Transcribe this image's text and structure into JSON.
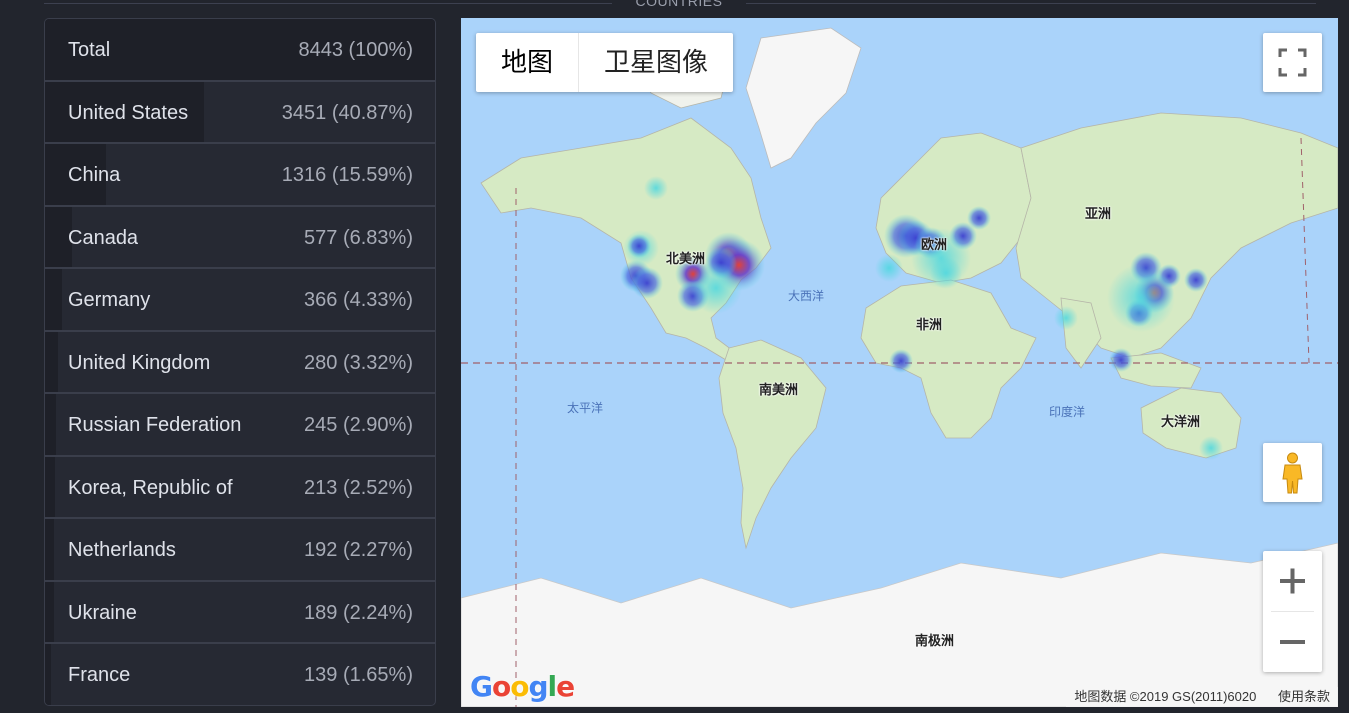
{
  "section_title": "COUNTRIES",
  "countries": [
    {
      "name": "Total",
      "count": "8443 (100%)",
      "share": 1.0
    },
    {
      "name": "United States",
      "count": "3451 (40.87%)",
      "share": 0.4087
    },
    {
      "name": "China",
      "count": "1316 (15.59%)",
      "share": 0.1559
    },
    {
      "name": "Canada",
      "count": "577 (6.83%)",
      "share": 0.0683
    },
    {
      "name": "Germany",
      "count": "366 (4.33%)",
      "share": 0.0433
    },
    {
      "name": "United Kingdom",
      "count": "280 (3.32%)",
      "share": 0.0332
    },
    {
      "name": "Russian Federation",
      "count": "245 (2.90%)",
      "share": 0.029
    },
    {
      "name": "Korea, Republic of",
      "count": "213 (2.52%)",
      "share": 0.0252
    },
    {
      "name": "Netherlands",
      "count": "192 (2.27%)",
      "share": 0.0227
    },
    {
      "name": "Ukraine",
      "count": "189 (2.24%)",
      "share": 0.0224
    },
    {
      "name": "France",
      "count": "139 (1.65%)",
      "share": 0.0165
    }
  ],
  "map": {
    "type_buttons": [
      "地图",
      "卫星图像"
    ],
    "active_type": "地图",
    "labels": {
      "north_america": "北美洲",
      "europe": "欧洲",
      "asia": "亚洲",
      "africa": "非洲",
      "south_america": "南美洲",
      "oceania": "大洋洲",
      "antarctica": "南极洲",
      "atlantic": "大西洋",
      "pacific": "太平洋",
      "indian": "印度洋"
    },
    "logo": "Google",
    "attribution": "地图数据 ©2019 GS(2011)6020",
    "terms": "使用条款",
    "controls": {
      "fullscreen": "fullscreen-icon",
      "pegman": "pegman-icon",
      "zoom_in": "plus-icon",
      "zoom_out": "minus-icon"
    }
  },
  "colors": {
    "page_bg": "#22252d",
    "table_bg": "#262933",
    "bar": "#1e2028",
    "water": "#aad3fa",
    "land": "#d6eac4",
    "ice": "#f6f6f6",
    "heat_low": "#4cd7e0",
    "heat_mid": "#4b4fd6",
    "heat_high": "#e0433a"
  }
}
